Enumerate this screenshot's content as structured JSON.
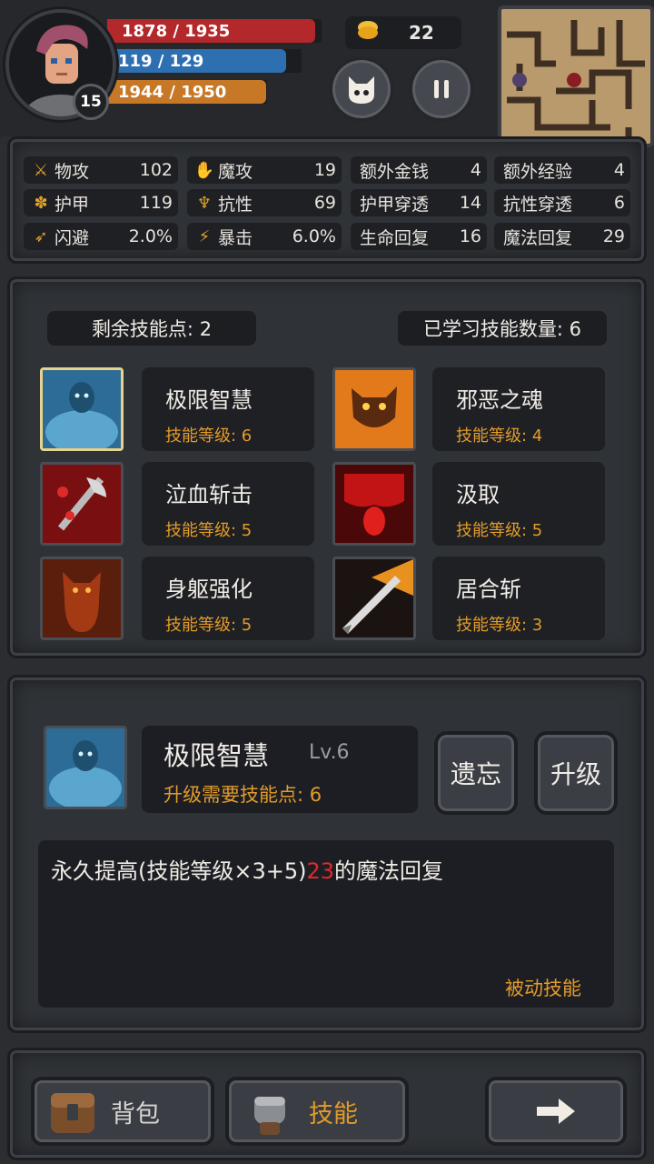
{
  "player": {
    "level": "15",
    "hp_text": "1878 / 1935",
    "mp_text": "119 / 129",
    "xp_text": "1944 / 1950",
    "hp_ratio": 0.97,
    "mp_ratio": 0.92,
    "xp_ratio": 0.997
  },
  "gold": {
    "amount": "22"
  },
  "controls": {
    "pet_icon": "monster-face-icon",
    "pause_icon": "pause-icon"
  },
  "stats": [
    {
      "icon": "sword-icon",
      "glyph": "⚔",
      "label": "物攻",
      "value": "102"
    },
    {
      "icon": "magic-hand-icon",
      "glyph": "✋",
      "label": "魔攻",
      "value": "19"
    },
    {
      "icon": "",
      "glyph": "",
      "label": "额外金钱",
      "value": "4"
    },
    {
      "icon": "",
      "glyph": "",
      "label": "额外经验",
      "value": "4"
    },
    {
      "icon": "paw-armor-icon",
      "glyph": "✽",
      "label": "护甲",
      "value": "119"
    },
    {
      "icon": "strength-icon",
      "glyph": "♆",
      "label": "抗性",
      "value": "69"
    },
    {
      "icon": "",
      "glyph": "",
      "label": "护甲穿透",
      "value": "14"
    },
    {
      "icon": "",
      "glyph": "",
      "label": "抗性穿透",
      "value": "6"
    },
    {
      "icon": "running-icon",
      "glyph": "➶",
      "label": "闪避",
      "value": "2.0%"
    },
    {
      "icon": "lightning-icon",
      "glyph": "⚡",
      "label": "暴击",
      "value": "6.0%"
    },
    {
      "icon": "",
      "glyph": "",
      "label": "生命回复",
      "value": "16"
    },
    {
      "icon": "",
      "glyph": "",
      "label": "魔法回复",
      "value": "29"
    }
  ],
  "skills_header": {
    "remaining": "剩余技能点: 2",
    "learned": "已学习技能数量: 6"
  },
  "skills": [
    {
      "name": "极限智慧",
      "level": "技能等级: 6",
      "icon": "spirit-icon",
      "color": "#3e88b4",
      "selected": true
    },
    {
      "name": "邪恶之魂",
      "level": "技能等级: 4",
      "icon": "demon-soul-icon",
      "color": "#d86a1a",
      "selected": false
    },
    {
      "name": "泣血斩击",
      "level": "技能等级: 5",
      "icon": "blood-axe-icon",
      "color": "#a51818",
      "selected": false
    },
    {
      "name": "汲取",
      "level": "技能等级: 5",
      "icon": "blood-drain-icon",
      "color": "#b81414",
      "selected": false
    },
    {
      "name": "身躯强化",
      "level": "技能等级: 5",
      "icon": "demon-body-icon",
      "color": "#9a3c12",
      "selected": false
    },
    {
      "name": "居合斩",
      "level": "技能等级: 3",
      "icon": "flaming-blade-icon",
      "color": "#d8781a",
      "selected": false
    }
  ],
  "detail": {
    "name": "极限智慧",
    "level": "Lv.6",
    "cost": "升级需要技能点: 6",
    "forget_label": "遗忘",
    "upgrade_label": "升级",
    "desc_prefix": "永久提高(技能等级×3+5)",
    "desc_value": "23",
    "desc_suffix": "的魔法回复",
    "type": "被动技能"
  },
  "bottom": {
    "bag_label": "背包",
    "skill_label": "技能",
    "next_icon": "arrow-right-icon"
  },
  "colors": {
    "accent": "#e29b2a",
    "hp": "#b3282a",
    "mp": "#2d6fb0",
    "xp": "#c77826",
    "highlight": "#e02a2a"
  }
}
